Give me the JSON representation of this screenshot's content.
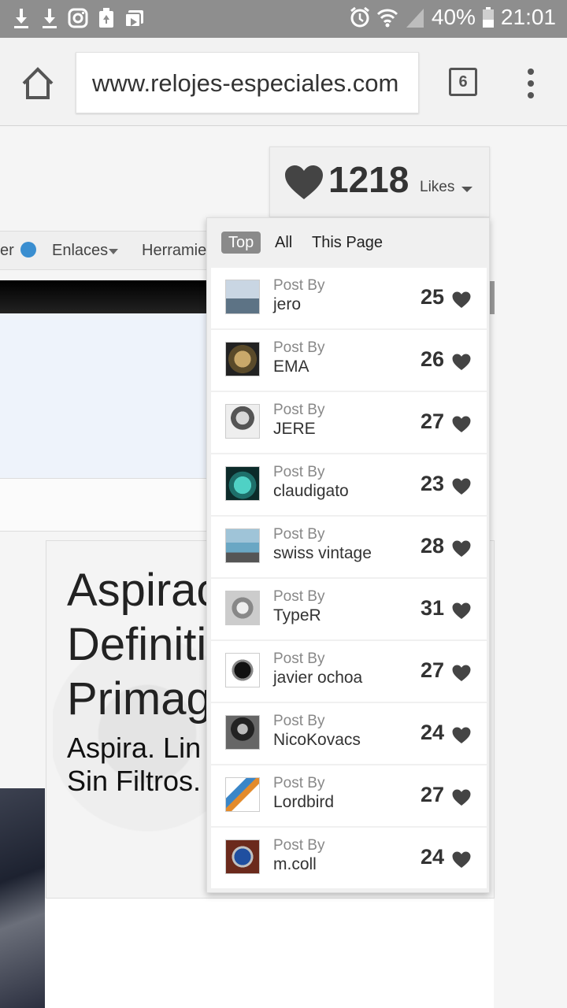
{
  "status_bar": {
    "battery": "40%",
    "time": "21:01",
    "icons": [
      "download-icon",
      "download-icon",
      "instagram-icon",
      "recycle-icon",
      "gallery-icon",
      "alarm-icon",
      "wifi-icon",
      "signal-icon",
      "battery-icon"
    ]
  },
  "browser": {
    "url": "www.relojes-especiales.com",
    "tab_count": "6",
    "icons": [
      "home-icon",
      "tabs-icon",
      "more-vert-icon"
    ]
  },
  "page": {
    "nav": {
      "item1": "er",
      "item2": "Enlaces",
      "item3": "Herramie"
    },
    "article": {
      "title": "Aspirac\nDefiniti\nPrimag",
      "subtitle": "Aspira. Lin\nSin Filtros."
    }
  },
  "likes": {
    "count": "1218",
    "label": "Likes",
    "filters": [
      "Top",
      "All",
      "This Page"
    ],
    "active_filter": "Top",
    "post_by_label": "Post By",
    "items": [
      {
        "user": "jero",
        "count": "25",
        "thumb": "sailboat"
      },
      {
        "user": "EMA",
        "count": "26",
        "thumb": "pocket-watch"
      },
      {
        "user": "JERE",
        "count": "27",
        "thumb": "man-portrait"
      },
      {
        "user": "claudigato",
        "count": "23",
        "thumb": "cat"
      },
      {
        "user": "swiss vintage",
        "count": "28",
        "thumb": "vintage-car"
      },
      {
        "user": "TypeR",
        "count": "31",
        "thumb": "watch-bw"
      },
      {
        "user": "javier ochoa",
        "count": "27",
        "thumb": "black-watch"
      },
      {
        "user": "NicoKovacs",
        "count": "24",
        "thumb": "tesla-portrait"
      },
      {
        "user": "Lordbird",
        "count": "27",
        "thumb": "bird"
      },
      {
        "user": "m.coll",
        "count": "24",
        "thumb": "blue-watch"
      }
    ]
  }
}
